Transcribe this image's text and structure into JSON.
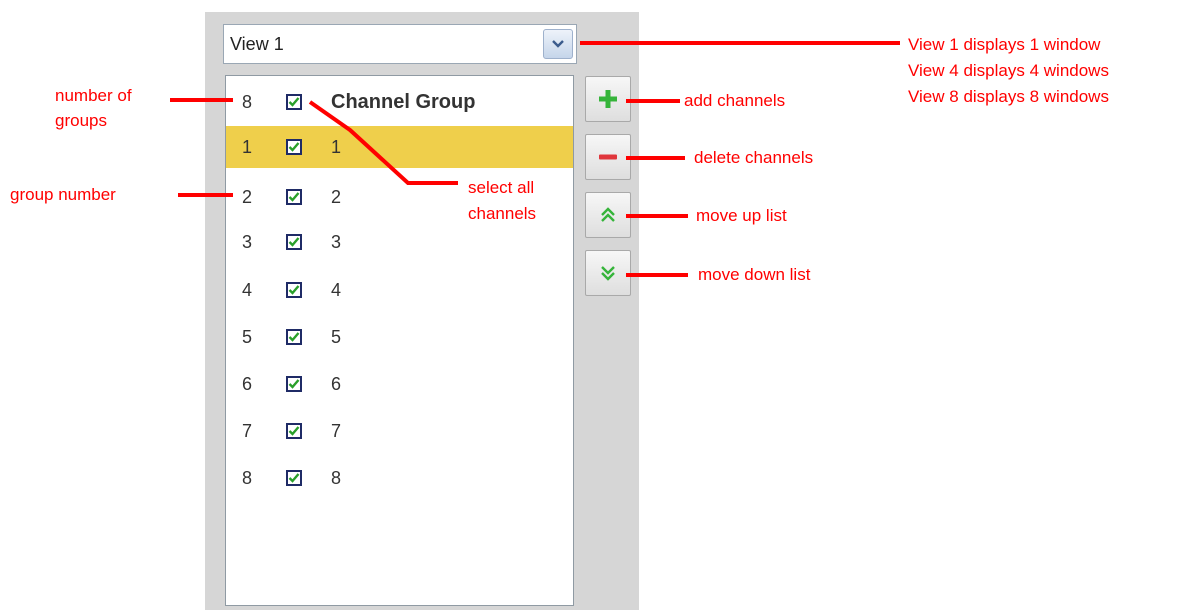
{
  "view_select": {
    "value": "View 1"
  },
  "list": {
    "header": {
      "count": "8",
      "label": "Channel Group"
    },
    "rows": [
      {
        "num": "1",
        "label": "1",
        "selected": true
      },
      {
        "num": "2",
        "label": "2"
      },
      {
        "num": "3",
        "label": "3"
      },
      {
        "num": "4",
        "label": "4"
      },
      {
        "num": "5",
        "label": "5"
      },
      {
        "num": "6",
        "label": "6"
      },
      {
        "num": "7",
        "label": "7"
      },
      {
        "num": "8",
        "label": "8"
      }
    ]
  },
  "buttons": {
    "add": {
      "icon": "plus-icon"
    },
    "delete": {
      "icon": "minus-icon"
    },
    "up": {
      "icon": "double-chevron-up-icon"
    },
    "down": {
      "icon": "double-chevron-down-icon"
    }
  },
  "annotations": {
    "view_1": "View 1 displays 1 window",
    "view_4": "View 4 displays 4 windows",
    "view_8": "View 8 displays 8 windows",
    "number_of_groups_1": "number of",
    "number_of_groups_2": "groups",
    "group_number": "group number",
    "select_all_1": "select all",
    "select_all_2": "channels",
    "add_channels": "add channels",
    "delete_channels": "delete channels",
    "move_up": "move up list",
    "move_down": "move down list"
  },
  "colors": {
    "annotation": "#ff0000",
    "selected_row": "#efcf4b",
    "panel": "#d6d6d6",
    "check": "#2aa02a"
  }
}
